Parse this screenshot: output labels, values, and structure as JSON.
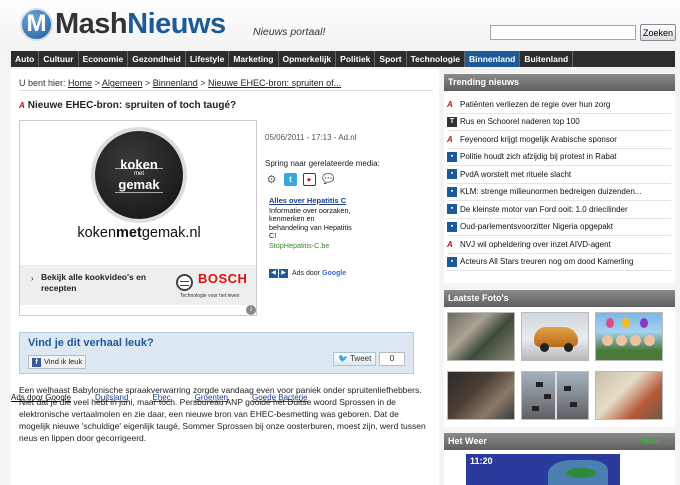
{
  "header": {
    "logo_letter": "M",
    "logo_mash": "Mash",
    "logo_nieuws": "Nieuws",
    "tagline": "Nieuws portaal!",
    "search_placeholder": "",
    "search_button": "Zoeken"
  },
  "nav": {
    "items": [
      {
        "label": "Auto"
      },
      {
        "label": "Cultuur"
      },
      {
        "label": "Economie"
      },
      {
        "label": "Gezondheid"
      },
      {
        "label": "Lifestyle"
      },
      {
        "label": "Marketing"
      },
      {
        "label": "Opmerkelijk"
      },
      {
        "label": "Politiek"
      },
      {
        "label": "Sport"
      },
      {
        "label": "Technologie"
      },
      {
        "label": "Binnenland"
      },
      {
        "label": "Buitenland"
      }
    ],
    "active": "Binnenland"
  },
  "breadcrumb": {
    "prefix": "U bent hier:",
    "home": "Home",
    "category": "Algemeen",
    "subcategory": "Binnenland",
    "current": "Nieuwe EHEC-bron: spruiten of...",
    "sep": ">"
  },
  "article": {
    "source_badge": "A",
    "title": "Nieuwe EHEC-bron: spruiten of toch taugé?",
    "meta": "05/06/2011 - 17:13 - Ad.nl",
    "jump_label": "Spring naar gerelateerde media:",
    "body": "Een welhaast Babylonische spraakverwarring zorgde vandaag even voor paniek onder spruitenliefhebbers. Niet dat je die veel hebt in juni, maar toch. Persbureau ANP gooide het Duitse woord Sprossen in de elektronische vertaalmolen en zie daar, een nieuwe bron van EHEC-besmetting was geboren. Dat de mogelijk nieuwe 'schuldige' eigenlijk taugé, Sommer Sprossen bij onze oosterburen, moest zijn, werd tussen neus en lippen door gecorrigeerd."
  },
  "ad": {
    "koken": "koken",
    "met": "met",
    "gemak": "gemak",
    "domain_a": "koken",
    "domain_b": "met",
    "domain_c": "gemak.nl",
    "cta": "Bekijk alle kookvideo's en recepten",
    "brand": "BOSCH",
    "slogan": "Technologie voor het leven",
    "adchoices": "i"
  },
  "adlinks": {
    "title": "Alles over Hepatitis C",
    "body": "Informatie over oorzaken, kenmerken en behandeling van Hepatitis C!",
    "url": "StopHepatitis-C.be",
    "footer_label": "Ads door",
    "footer_brand": "Google"
  },
  "share": {
    "question": "Vind je dit verhaal leuk?",
    "fb_label": "Vind ik leuk",
    "tweet_label": "Tweet",
    "tweet_count": "0"
  },
  "bottom_ads": {
    "label": "Ads door Google",
    "links": [
      "Duitsland",
      "Ehec",
      "Groenten",
      "Goede Bacterie"
    ]
  },
  "sidebar": {
    "trending_title": "Trending nieuws",
    "trending": [
      {
        "icon": "anp",
        "text": "Patiënten verliezen de regie over hun zorg"
      },
      {
        "icon": "t",
        "text": "Rus en Schoorel naderen top 100"
      },
      {
        "icon": "anp",
        "text": "Feyenoord krijgt mogelijk Arabische sponsor"
      },
      {
        "icon": "square",
        "text": "Politie houdt zich afzijdig bij protest in Rabat"
      },
      {
        "icon": "square",
        "text": "PvdA worstelt met rituele slacht"
      },
      {
        "icon": "square",
        "text": "KLM: strenge milieunormen bedreigen duizenden..."
      },
      {
        "icon": "square",
        "text": "De kleinste motor van Ford ooit: 1.0 driecilinder"
      },
      {
        "icon": "square",
        "text": "Oud-parlementsvoorzitter Nigeria opgepakt"
      },
      {
        "icon": "anp",
        "text": "NVJ wil opheldering over inzet AIVD-agent"
      },
      {
        "icon": "square",
        "text": "Acteurs All Stars treuren nog om dood Kamerling"
      }
    ],
    "photos_title": "Laatste Foto's",
    "weather_title": "Het Weer",
    "weather_more": "Meer...",
    "weather_time": "11:20"
  },
  "colors": {
    "brand_blue": "#1d5a97",
    "nav_bg": "#2d2d2d",
    "anp_red": "#c01010",
    "weather_green": "#39b238"
  }
}
